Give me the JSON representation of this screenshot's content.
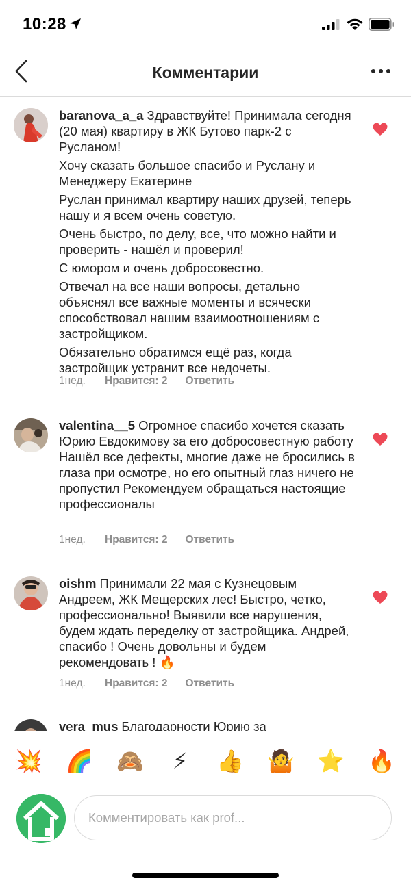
{
  "status_bar": {
    "time": "10:28"
  },
  "header": {
    "title": "Комментарии"
  },
  "comments": [
    {
      "username": "baranova_a_a",
      "paragraphs": [
        "Здравствуйте! Принимала сегодня (20 мая) квартиру в ЖК Бутово парк-2 с Русланом!",
        "Хочу сказать большое спасибо и Руслану и Менеджеру Екатерине",
        "Руслан принимал квартиру наших друзей, теперь нашу и я всем очень советую.",
        "Очень быстро, по делу, все, что можно найти и проверить - нашёл и проверил!",
        "С юмором и очень добросовестно.",
        "Отвечал на все наши вопросы, детально объяснял все важные моменты и всячески способствовал нашим взаимоотношениям с застройщиком.",
        "Обязательно обратимся ещё раз, когда застройщик устранит все недочеты."
      ],
      "time": "1нед.",
      "likes": "Нравится: 2",
      "reply": "Ответить"
    },
    {
      "username": "valentina__5",
      "paragraphs": [
        "Огромное спасибо хочется сказать Юрию Евдокимову за его добросовестную работу Нашёл все дефекты, многие даже не бросились в глаза при осмотре, но его опытный глаз ничего не пропустил Рекомендуем обращаться настоящие профессионалы"
      ],
      "time": "1нед.",
      "likes": "Нравится: 2",
      "reply": "Ответить"
    },
    {
      "username": "oishm",
      "paragraphs": [
        "Принимали 22 мая с Кузнецовым Андреем, ЖК Мещерских лес! Быстро, четко, профессионально! Выявили все нарушения, будем ждать переделку от застройщика. Андрей, спасибо ! Очень довольны и будем рекомендовать ! 🔥"
      ],
      "time": "1нед.",
      "likes": "Нравится: 2",
      "reply": "Ответить"
    },
    {
      "username": "vera_mus",
      "paragraphs": [
        "Благодарности Юрию за"
      ]
    }
  ],
  "emoji_bar": [
    "💥",
    "🌈",
    "🙈",
    "⚡",
    "👍",
    "🤷",
    "⭐",
    "🔥"
  ],
  "composer": {
    "placeholder": "Комментировать как prof..."
  },
  "colors": {
    "heart": "#ed4956",
    "meta": "#8e8e8e",
    "text": "#262626",
    "avatar_green": "#36b866"
  },
  "icons": [
    "location-arrow-icon",
    "signal-icon",
    "wifi-icon",
    "battery-icon",
    "back-chevron-icon",
    "more-dots-icon",
    "heart-icon",
    "home-icon"
  ]
}
